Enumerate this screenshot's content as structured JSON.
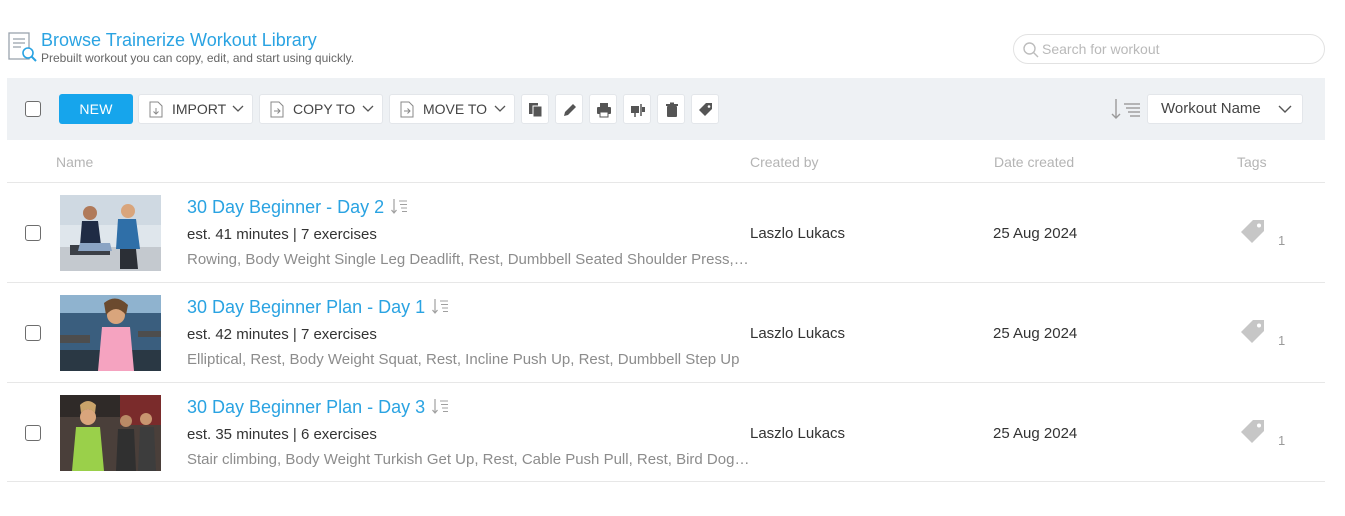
{
  "header": {
    "title": "Browse Trainerize Workout Library",
    "subtitle": "Prebuilt workout you can copy, edit, and start using quickly.",
    "search_placeholder": "Search for workout"
  },
  "toolbar": {
    "new_label": "NEW",
    "import_label": "IMPORT",
    "copy_label": "COPY TO",
    "move_label": "MOVE TO",
    "icon_buttons": [
      "duplicate-icon",
      "pencil-icon",
      "printer-icon",
      "assign-icon",
      "trash-icon",
      "tag-icon"
    ],
    "sort_value": "Workout Name"
  },
  "columns": {
    "name": "Name",
    "created_by": "Created by",
    "date_created": "Date created",
    "tags": "Tags"
  },
  "workouts": [
    {
      "title": "30 Day Beginner - Day 2",
      "meta": "est. 41 minutes | 7 exercises",
      "exercises": "Rowing, Body Weight Single Leg Deadlift, Rest, Dumbbell Seated Shoulder Press, Rest, Plank",
      "created_by": "Laszlo Lukacs",
      "date": "25 Aug 2024",
      "tag_count": "1"
    },
    {
      "title": "30 Day Beginner Plan - Day 1",
      "meta": "est. 42 minutes | 7 exercises",
      "exercises": "Elliptical, Rest, Body Weight Squat, Rest, Incline Push Up, Rest, Dumbbell Step Up",
      "created_by": "Laszlo Lukacs",
      "date": "25 Aug 2024",
      "tag_count": "1"
    },
    {
      "title": "30 Day Beginner Plan - Day 3",
      "meta": "est. 35 minutes | 6 exercises",
      "exercises": "Stair climbing, Body Weight Turkish Get Up, Rest, Cable Push Pull, Rest, Bird Dog, Rest",
      "created_by": "Laszlo Lukacs",
      "date": "25 Aug 2024",
      "tag_count": "1"
    }
  ],
  "colors": {
    "accent": "#16a5ec",
    "link": "#2aa3e2",
    "toolbar_bg": "#eef1f4"
  }
}
